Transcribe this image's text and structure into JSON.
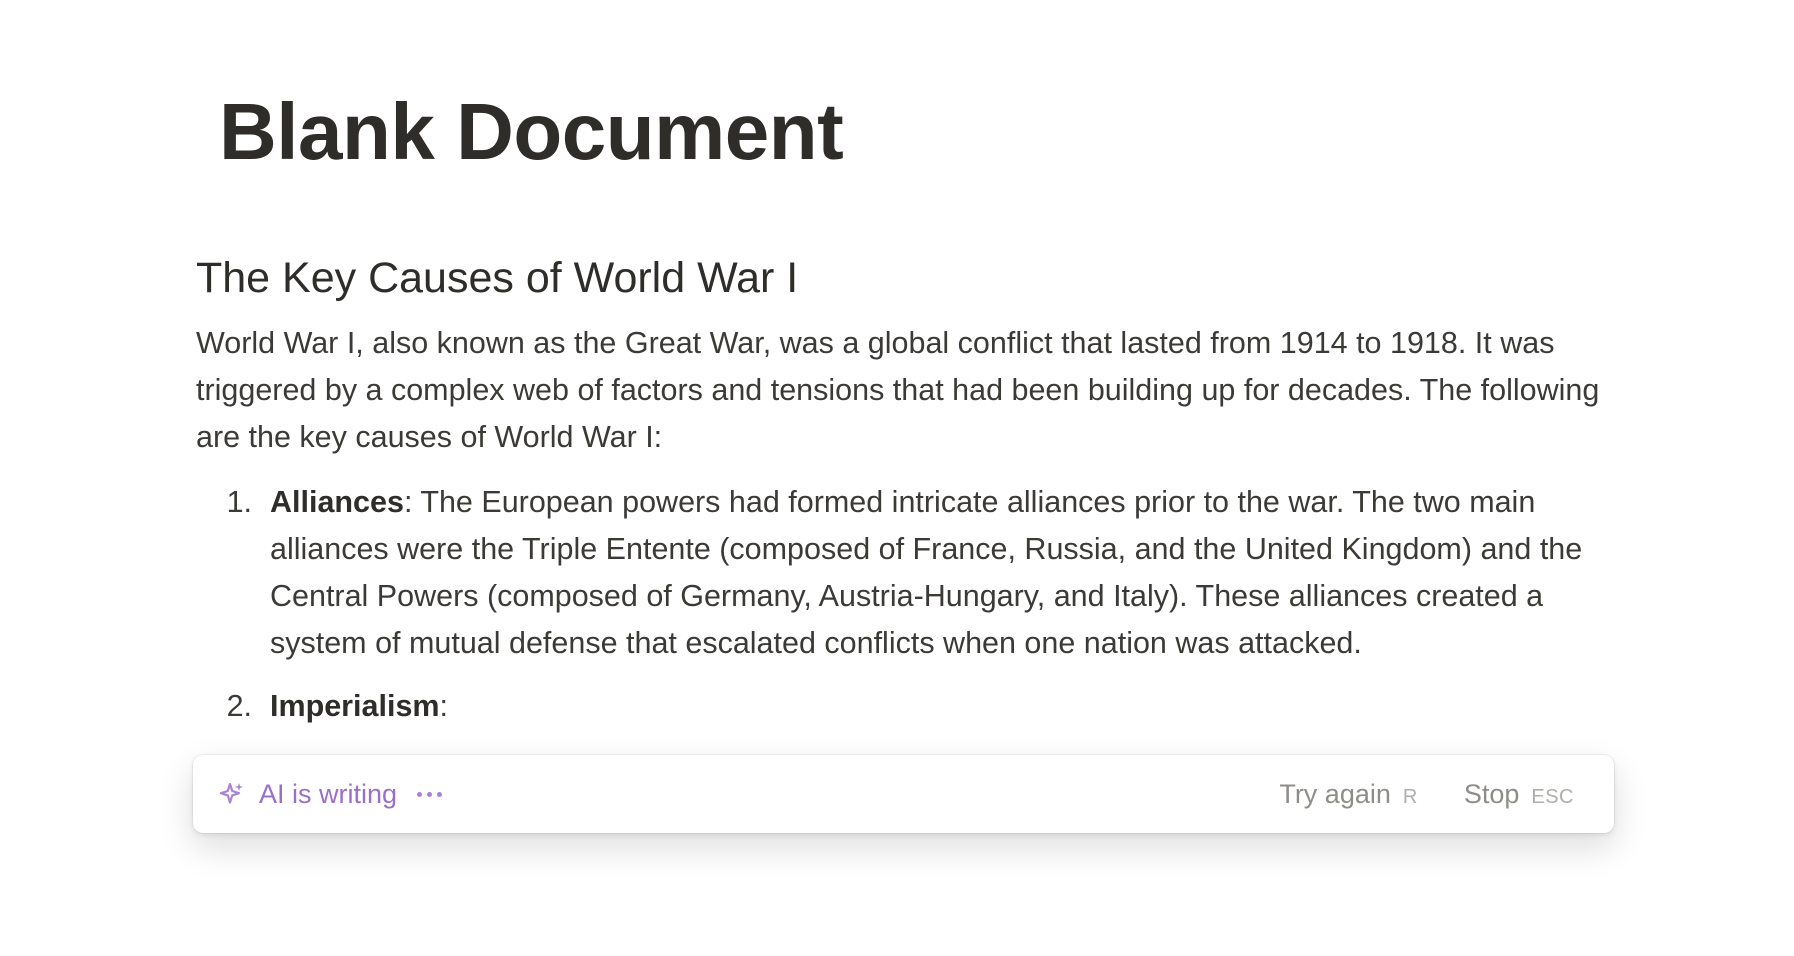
{
  "document": {
    "title": "Blank Document",
    "heading": "The Key Causes of World War I",
    "intro": "World War I, also known as the Great War, was a global conflict that lasted from 1914 to 1918. It was triggered by a complex web of factors and tensions that had been building up for decades. The following are the key causes of World War I:",
    "list": [
      {
        "number": "1.",
        "term": "Alliances",
        "text": ": The European powers had formed intricate alliances prior to the war. The two main alliances were the Triple Entente (composed of France, Russia, and the United Kingdom) and the Central Powers (composed of Germany, Austria-Hungary, and Italy). These alliances created a system of mutual defense that escalated conflicts when one nation was attacked."
      },
      {
        "number": "2.",
        "term": "Imperialism",
        "text": ":"
      }
    ]
  },
  "ai_bar": {
    "status": "AI is writing",
    "sparkle_icon": "sparkle-icon",
    "dots_icon": "ellipsis-dots-icon",
    "accent_color": "#9b6fc9",
    "actions": [
      {
        "label": "Try again",
        "shortcut": "R"
      },
      {
        "label": "Stop",
        "shortcut": "ESC"
      }
    ]
  }
}
